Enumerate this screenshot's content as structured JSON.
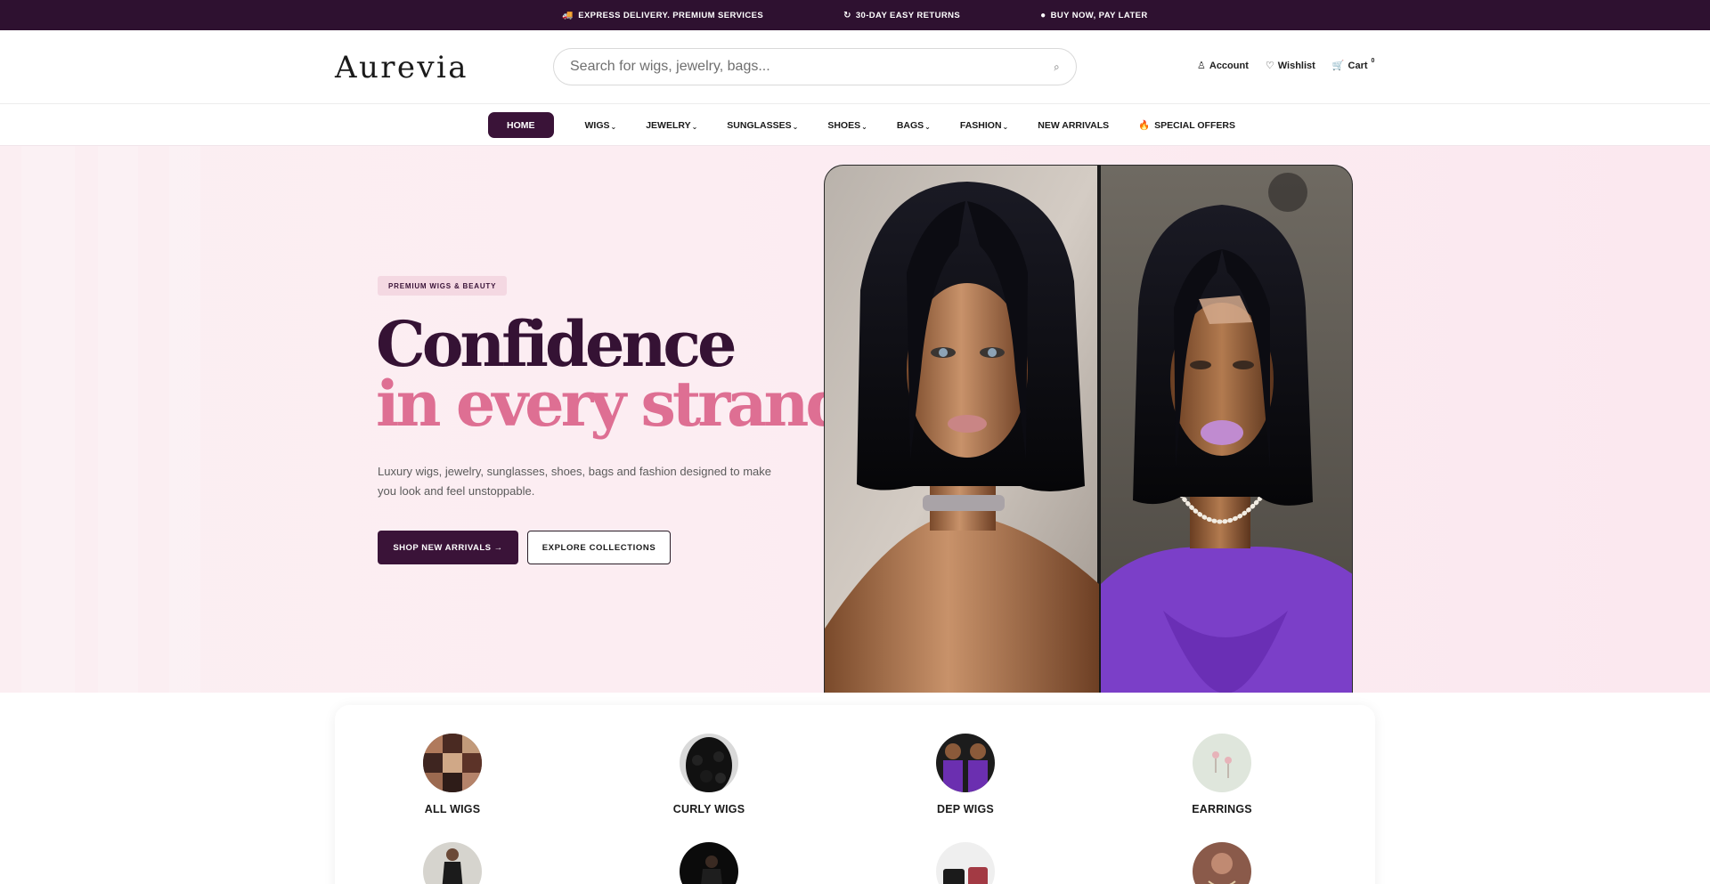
{
  "topbar": {
    "items": [
      {
        "icon": "truck-icon",
        "glyph": "🚚",
        "text": "EXPRESS DELIVERY. PREMIUM SERVICES"
      },
      {
        "icon": "return-arrow-icon",
        "glyph": "↻",
        "text": "30-DAY EASY RETURNS"
      },
      {
        "icon": "dot-icon",
        "glyph": "●",
        "text": "BUY NOW, PAY LATER"
      }
    ]
  },
  "header": {
    "logo": "Aurevia",
    "search": {
      "placeholder": "Search for wigs, jewelry, bags...",
      "value": "",
      "icon": "search-icon",
      "glyph": "⌕"
    },
    "account_label": "Account",
    "account_glyph": "♙",
    "wishlist_label": "Wishlist",
    "wishlist_glyph": "♡",
    "cart_label": "Cart",
    "cart_glyph": "🛒",
    "cart_count": "0"
  },
  "nav": {
    "items": [
      {
        "label": "HOME",
        "active": true,
        "dropdown": false
      },
      {
        "label": "WIGS",
        "dropdown": true
      },
      {
        "label": "JEWELRY",
        "dropdown": true
      },
      {
        "label": "SUNGLASSES",
        "dropdown": true
      },
      {
        "label": "SHOES",
        "dropdown": true
      },
      {
        "label": "BAGS",
        "dropdown": true
      },
      {
        "label": "FASHION",
        "dropdown": true
      },
      {
        "label": "NEW ARRIVALS",
        "dropdown": false
      },
      {
        "label": "SPECIAL OFFERS",
        "dropdown": false,
        "glyph": "🔥"
      }
    ],
    "chevron_glyph": "⌄"
  },
  "hero": {
    "badge": "PREMIUM WIGS & BEAUTY",
    "headline_line1": "Confidence",
    "headline_line2": "in every strand",
    "text": "Luxury wigs, jewelry, sunglasses, shoes, bags and fashion designed to make you look and feel unstoppable.",
    "primary_button": "SHOP NEW ARRIVALS →",
    "secondary_button": "EXPLORE COLLECTIONS"
  },
  "categories": [
    {
      "label": "ALL WIGS"
    },
    {
      "label": "CURLY WIGS"
    },
    {
      "label": "DEP WIGS"
    },
    {
      "label": "EARRINGS"
    },
    {
      "label": ""
    },
    {
      "label": ""
    },
    {
      "label": ""
    },
    {
      "label": ""
    }
  ],
  "colors": {
    "brand_dark": "#3a1338",
    "accent_pink": "#de6f93",
    "hero_bg": "#fbeef2"
  }
}
